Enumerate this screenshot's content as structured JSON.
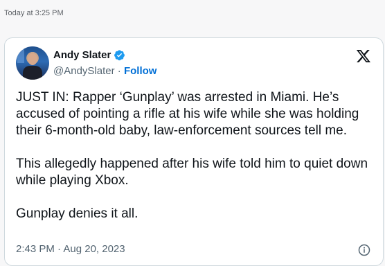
{
  "message_meta": {
    "timestamp": "Today at 3:25 PM"
  },
  "tweet": {
    "author_name": "Andy Slater",
    "handle": "@AndySlater",
    "separator": " · ",
    "follow_label": "Follow",
    "verified": true,
    "text": "JUST IN: Rapper ‘Gunplay’ was arrested in Miami. He’s accused of pointing a rifle at his wife while she was holding their 6-month-old baby, law-enforcement sources tell me.\n\nThis allegedly happened after his wife told him to quiet down while playing Xbox.\n\nGunplay denies it all.",
    "posted_at": "2:43 PM · Aug 20, 2023"
  },
  "icons": {
    "verified": "verified-badge-icon",
    "platform": "x-logo-icon",
    "info": "info-icon"
  },
  "colors": {
    "link": "#006fd6",
    "verified": "#1d9bf0",
    "text": "#0f1419",
    "muted": "#536471"
  }
}
